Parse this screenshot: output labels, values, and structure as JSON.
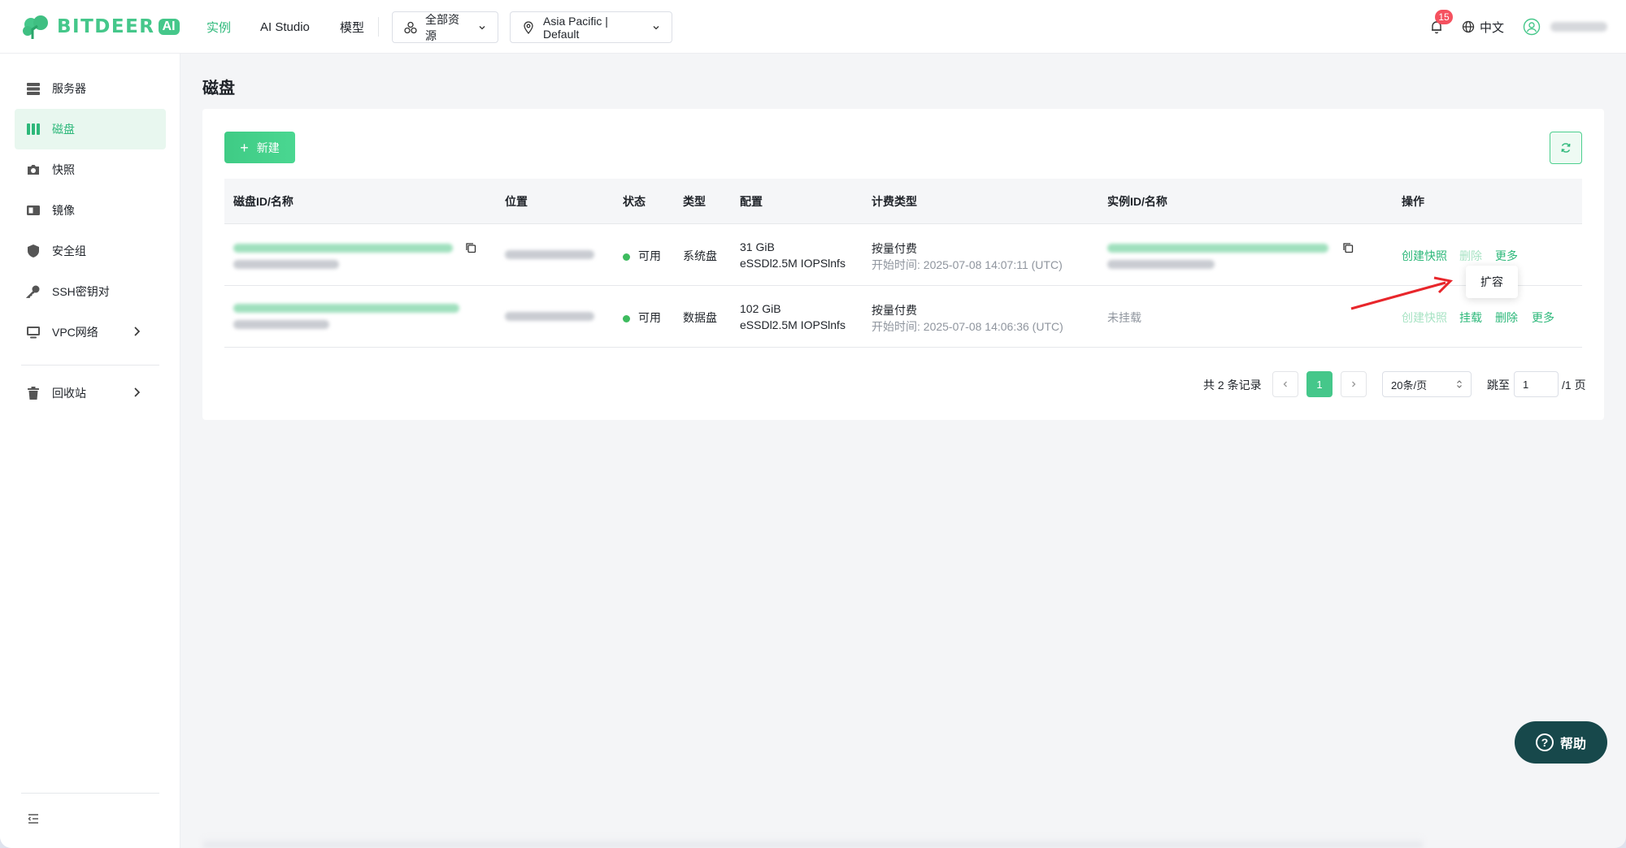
{
  "header": {
    "logo_text": "BITDEER",
    "logo_badge": "AI",
    "nav": [
      "实例",
      "AI Studio",
      "模型"
    ],
    "resource_select": "全部资源",
    "region_select": "Asia Pacific | Default",
    "notification_count": "15",
    "language": "中文"
  },
  "sidebar": {
    "items": [
      {
        "label": "服务器",
        "icon": "server-icon"
      },
      {
        "label": "磁盘",
        "icon": "disk-icon"
      },
      {
        "label": "快照",
        "icon": "camera-icon"
      },
      {
        "label": "镜像",
        "icon": "image-icon"
      },
      {
        "label": "安全组",
        "icon": "shield-icon"
      },
      {
        "label": "SSH密钥对",
        "icon": "key-icon"
      },
      {
        "label": "VPC网络",
        "icon": "monitor-icon"
      },
      {
        "label": "回收站",
        "icon": "trash-icon"
      }
    ]
  },
  "page": {
    "title": "磁盘",
    "new_button": "新建"
  },
  "table": {
    "columns": [
      "磁盘ID/名称",
      "位置",
      "状态",
      "类型",
      "配置",
      "计费类型",
      "实例ID/名称",
      "操作"
    ],
    "rows": [
      {
        "status": "可用",
        "type": "系统盘",
        "config_size": "31 GiB",
        "config_perf": "eSSDl2.5M IOPSlnfs",
        "billing": "按量付费",
        "start_time": "开始时间: 2025-07-08 14:07:11 (UTC)",
        "instance": "",
        "actions": [
          "创建快照",
          "删除",
          "更多"
        ]
      },
      {
        "status": "可用",
        "type": "数据盘",
        "config_size": "102 GiB",
        "config_perf": "eSSDl2.5M IOPSlnfs",
        "billing": "按量付费",
        "start_time": "开始时间: 2025-07-08 14:06:36 (UTC)",
        "instance": "未挂载",
        "actions": [
          "创建快照",
          "挂载",
          "删除",
          "更多"
        ]
      }
    ],
    "more_menu": [
      "扩容"
    ]
  },
  "pagination": {
    "total": "共 2 条记录",
    "current_page": "1",
    "page_size": "20条/页",
    "jump_label": "跳至",
    "jump_value": "1",
    "page_suffix": "/1 页"
  },
  "help_button": "帮助",
  "colors": {
    "brand": "#45c78a",
    "link": "#2db87a",
    "status_available": "#3dbb5e",
    "badge": "#f5515f",
    "help_bg": "#17484b",
    "annotation_arrow": "#e8262b"
  }
}
